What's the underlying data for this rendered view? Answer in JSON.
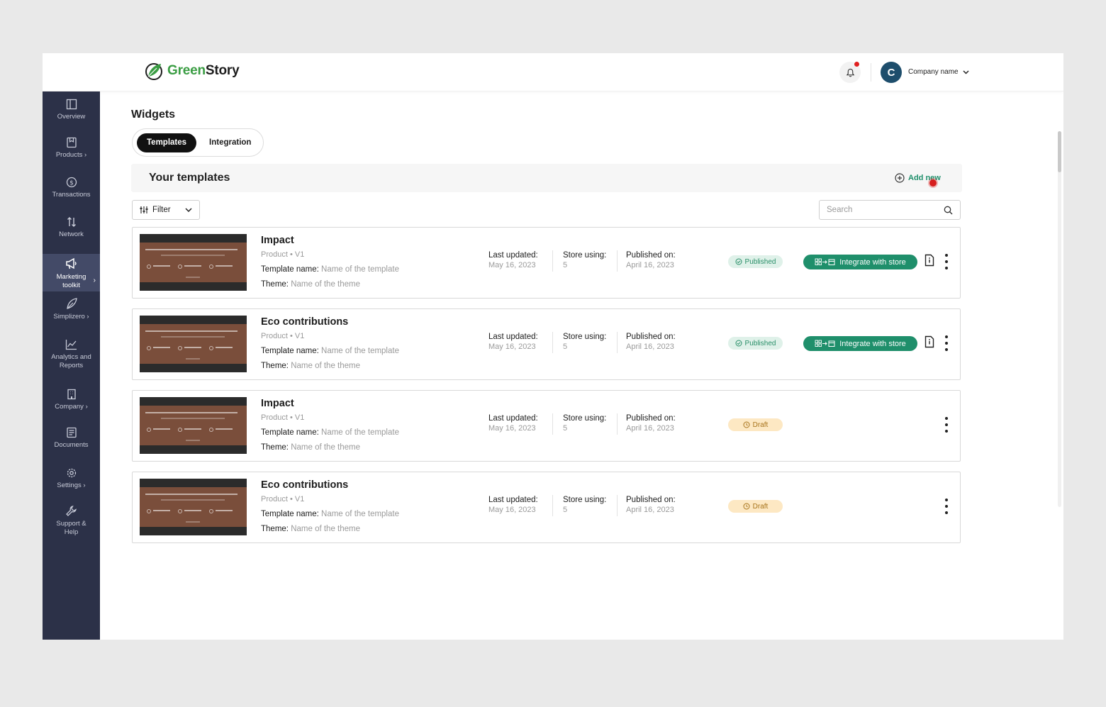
{
  "app": {
    "brand_green": "Green",
    "brand_dark": "Story"
  },
  "header": {
    "company_initial": "C",
    "company_name": "Company name"
  },
  "sidebar": {
    "items": [
      {
        "label": "Overview",
        "icon": "layout-icon"
      },
      {
        "label": "Products ›",
        "icon": "bookmark-icon"
      },
      {
        "label": "Transactions",
        "icon": "dollar-icon"
      },
      {
        "label": "Network",
        "icon": "arrows-icon"
      },
      {
        "label": "Marketing toolkit",
        "icon": "megaphone-icon",
        "active": true
      },
      {
        "label": "Simplizero ›",
        "icon": "leaf-icon"
      },
      {
        "label": "Analytics and Reports",
        "icon": "chart-icon"
      },
      {
        "label": "Company ›",
        "icon": "building-icon"
      },
      {
        "label": "Documents",
        "icon": "document-icon"
      },
      {
        "label": "Settings ›",
        "icon": "gear-icon"
      },
      {
        "label": "Support & Help",
        "icon": "wrench-icon"
      }
    ]
  },
  "page": {
    "title": "Widgets",
    "tabs": [
      "Templates",
      "Integration"
    ],
    "section_title": "Your templates",
    "add_new": "Add new",
    "filter_label": "Filter",
    "search_placeholder": "Search"
  },
  "labels": {
    "template_name": "Template name:",
    "theme": "Theme:",
    "last_updated": "Last updated:",
    "store_using": "Store using:",
    "published_on": "Published on:",
    "integrate": "Integrate with store"
  },
  "templates": [
    {
      "title": "Impact",
      "sub": "Product • V1",
      "template_name": "Name of the template",
      "theme": "Name of the theme",
      "last_updated": "May 16, 2023",
      "store_using": "5",
      "published_on": "April 16, 2023",
      "status": "Published"
    },
    {
      "title": "Eco contributions",
      "sub": "Product • V1",
      "template_name": "Name of the template",
      "theme": "Name of the theme",
      "last_updated": "May 16, 2023",
      "store_using": "5",
      "published_on": "April 16, 2023",
      "status": "Published"
    },
    {
      "title": "Impact",
      "sub": "Product • V1",
      "template_name": "Name of the template",
      "theme": "Name of the theme",
      "last_updated": "May 16, 2023",
      "store_using": "5",
      "published_on": "April 16, 2023",
      "status": "Draft"
    },
    {
      "title": "Eco contributions",
      "sub": "Product • V1",
      "template_name": "Name of the template",
      "theme": "Name of the theme",
      "last_updated": "May 16, 2023",
      "store_using": "5",
      "published_on": "April 16, 2023",
      "status": "Draft"
    }
  ],
  "colors": {
    "sidebar": "#2c3148",
    "accent": "#1f8f6b",
    "brand": "#3a9d43",
    "draft_bg": "#fde8c3",
    "published_bg": "#dff1e9"
  }
}
